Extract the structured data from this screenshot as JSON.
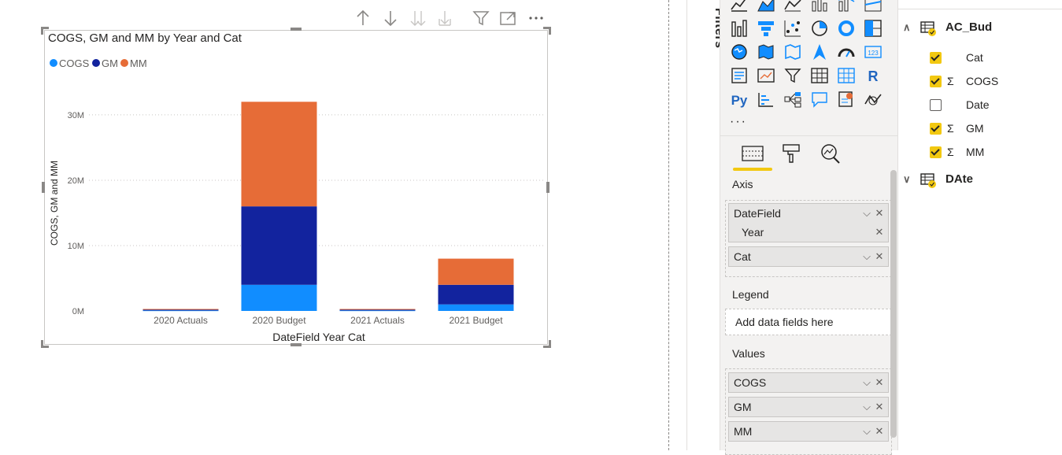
{
  "toolbar": {
    "icons": [
      "drill-up-icon",
      "drill-down-icon",
      "expand-all-icon",
      "expand-next-level-icon",
      "filter-icon",
      "focus-mode-icon",
      "more-options-icon"
    ]
  },
  "visual": {
    "title": "COGS, GM and MM by Year and Cat"
  },
  "colors": {
    "cogs": "#118dff",
    "gm": "#12239e",
    "mm": "#e66c37",
    "accent": "#f2c811"
  },
  "chart_data": {
    "type": "bar",
    "stacked": true,
    "title": "COGS, GM and MM by Year and Cat",
    "xlabel": "DateField Year Cat",
    "ylabel": "COGS, GM and MM",
    "categories": [
      "2020 Actuals",
      "2020 Budget",
      "2021 Actuals",
      "2021 Budget"
    ],
    "series": [
      {
        "name": "COGS",
        "values": [
          0.1,
          4.0,
          0.1,
          1.0
        ]
      },
      {
        "name": "GM",
        "values": [
          0.1,
          12.0,
          0.1,
          3.0
        ]
      },
      {
        "name": "MM",
        "values": [
          0.1,
          16.0,
          0.1,
          4.0
        ]
      }
    ],
    "yticks": [
      "0M",
      "10M",
      "20M",
      "30M"
    ],
    "ytick_values": [
      0,
      10,
      20,
      30
    ],
    "ylim": [
      0,
      33
    ],
    "legend_position": "top-left",
    "grid": true
  },
  "filters": {
    "label": "Filters"
  },
  "viz_pane": {
    "more": "···",
    "tabs": [
      "fields-tab",
      "format-tab",
      "analytics-tab"
    ],
    "wells": {
      "axis": {
        "label": "Axis",
        "fields": [
          {
            "name": "DateField",
            "sub": "Year"
          },
          {
            "name": "Cat"
          }
        ]
      },
      "legend": {
        "label": "Legend",
        "placeholder": "Add data fields here"
      },
      "values": {
        "label": "Values",
        "fields": [
          "COGS",
          "GM",
          "MM"
        ]
      }
    }
  },
  "fields_pane": {
    "tables": [
      {
        "name": "AC_Bud",
        "expanded": true,
        "fields": [
          {
            "name": "Cat",
            "checked": true,
            "sigma": false
          },
          {
            "name": "COGS",
            "checked": true,
            "sigma": true
          },
          {
            "name": "Date",
            "checked": false,
            "sigma": false
          },
          {
            "name": "GM",
            "checked": true,
            "sigma": true
          },
          {
            "name": "MM",
            "checked": true,
            "sigma": true
          }
        ]
      },
      {
        "name": "DAte",
        "expanded": true,
        "fields": []
      }
    ],
    "sigma_symbol": "Σ"
  }
}
